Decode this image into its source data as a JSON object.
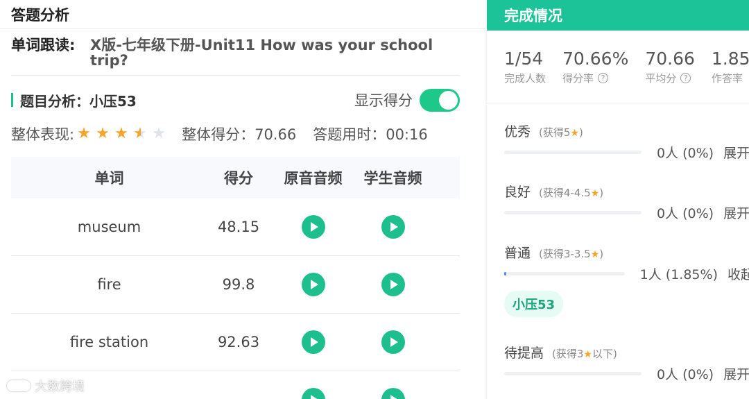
{
  "left": {
    "title": "答题分析",
    "reading_label": "单词跟读:",
    "reading_value": "X版-七年级下册-Unit11 How was your school trip?",
    "analysis_title": "题目分析：小压53",
    "show_score_label": "显示得分",
    "show_score_on": true,
    "overall_label": "整体表现:",
    "rating": 3.5,
    "rating_max": 5,
    "score_text": "整体得分：70.66",
    "time_text": "答题用时：00:16",
    "table": {
      "headers": [
        "单词",
        "得分",
        "原音音频",
        "学生音频"
      ],
      "rows": [
        {
          "word": "museum",
          "score": "48.15"
        },
        {
          "word": "fire",
          "score": "99.8"
        },
        {
          "word": "fire station",
          "score": "92.63"
        }
      ]
    },
    "watermark": "大数跨境"
  },
  "right": {
    "title": "完成情况",
    "stats": [
      {
        "value": "1/54",
        "label": "完成人数",
        "help": false
      },
      {
        "value": "70.66%",
        "label": "得分率",
        "help": true
      },
      {
        "value": "70.66",
        "label": "平均分",
        "help": true
      },
      {
        "value": "1.85",
        "label": "作答率",
        "help": false
      }
    ],
    "help_icon": "?",
    "levels": [
      {
        "name": "优秀",
        "hint": "(获得5",
        "hint_end": ")",
        "count": "0人 (0%)",
        "action": "展开",
        "fraction": 0
      },
      {
        "name": "良好",
        "hint": "(获得4-4.5",
        "hint_end": ")",
        "count": "0人 (0%)",
        "action": "展开",
        "fraction": 0
      },
      {
        "name": "普通",
        "hint": "(获得3-3.5",
        "hint_end": ")",
        "count": "1人 (1.85%)",
        "action": "收起",
        "fraction": 0.0185
      },
      {
        "name": "待提高",
        "hint": "(获得3",
        "hint_end": "以下)",
        "count": "0人 (0%)",
        "action": "展开",
        "fraction": 0
      }
    ],
    "student_chip": "小压53"
  },
  "colors": {
    "accent": "#1dbf8e",
    "header_green": "#1dc398",
    "star": "#f7a428",
    "bar_fill": "#4c8ef7"
  }
}
